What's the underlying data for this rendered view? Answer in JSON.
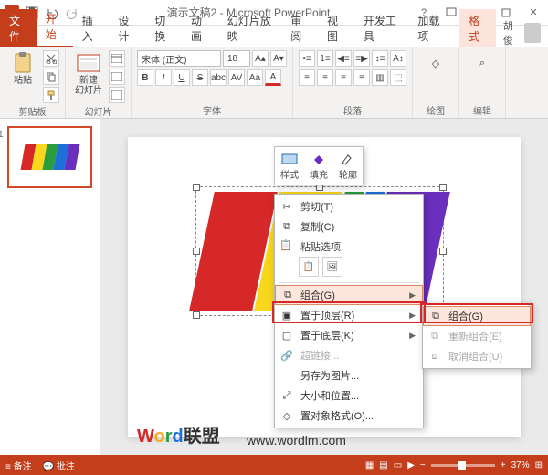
{
  "title": "演示文稿2 - Microsoft PowerPoint",
  "tabs": {
    "file": "文件",
    "home": "开始",
    "insert": "插入",
    "design": "设计",
    "transition": "切换",
    "animation": "动画",
    "slideshow": "幻灯片放映",
    "review": "审阅",
    "view": "视图",
    "dev": "开发工具",
    "addin": "加载项",
    "format": "格式"
  },
  "user": "胡俊",
  "ribbon": {
    "clipboard": {
      "paste": "粘贴",
      "label": "剪贴板"
    },
    "slides": {
      "new": "新建\n幻灯片",
      "label": "幻灯片"
    },
    "font": {
      "family": "宋体 (正文)",
      "size": "18",
      "label": "字体"
    },
    "para": {
      "label": "段落"
    },
    "drawing": {
      "label": "绘图"
    },
    "editing": {
      "label": "编辑"
    }
  },
  "thumb_num": "1",
  "minitoolbar": {
    "style": "样式",
    "fill": "填充",
    "outline": "轮廓"
  },
  "ctx": {
    "cut": "剪切(T)",
    "copy": "复制(C)",
    "pasteOptions": "粘贴选项:",
    "group": "组合(G)",
    "bringFront": "置于顶层(R)",
    "sendBack": "置于底层(K)",
    "hyperlink": "超链接...",
    "saveAsPic": "另存为图片...",
    "sizePos": "大小和位置...",
    "formatObj": "置对象格式(O)..."
  },
  "sub": {
    "group": "组合(G)",
    "regroup": "重新组合(E)",
    "ungroup": "取消组合(U)"
  },
  "status": {
    "notes": "备注",
    "comments": "批注",
    "zoom": "37%"
  },
  "watermark": {
    "w": "W",
    "o": "o",
    "r": "r",
    "d": "d",
    "rest": "联盟",
    "url": "www.wordlm.com"
  }
}
